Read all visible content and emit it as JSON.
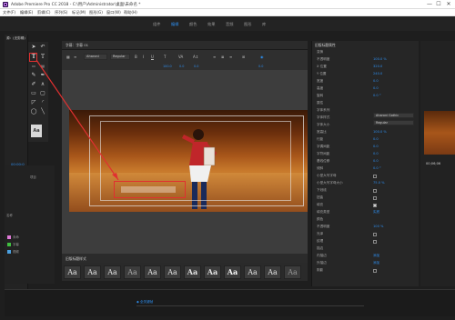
{
  "window": {
    "title": "Adobe Premiere Pro CC 2018 - C:\\用户\\Administrator\\桌面\\未命名 *",
    "controls": [
      "—",
      "☐",
      "✕"
    ]
  },
  "menu": [
    "文件(F)",
    "编辑(E)",
    "剪辑(C)",
    "序列(S)",
    "标记(M)",
    "图形(G)",
    "窗口(W)",
    "帮助(H)"
  ],
  "workspace_tabs": [
    "组件",
    "编辑",
    "颜色",
    "效果",
    "音频",
    "图形",
    "库"
  ],
  "left_panel": {
    "tab": "源：(无剪辑)",
    "timecode": "00;00;0"
  },
  "project_panel": {
    "labels": [
      "项目",
      "名称"
    ],
    "rows": [
      {
        "label": "未命",
        "color": "#e07ad8"
      },
      {
        "label": "字幕",
        "color": "#40c040"
      },
      {
        "label": "视频",
        "color": "#4aa0e0"
      }
    ]
  },
  "titler": {
    "title": "字幕：字幕 01",
    "font_family": "Aharoni",
    "font_style": "Regular",
    "values": [
      "100.0",
      "0.0",
      "0.0",
      "0.0",
      "0.0",
      "0.0"
    ],
    "styles_title": "旧版标题样式",
    "styles": [
      "Aa",
      "Aa",
      "Aa",
      "Aa",
      "Aa",
      "Aa",
      "Aa",
      "Aa",
      "Aa",
      "Aa",
      "Aa",
      "Aa"
    ]
  },
  "properties": {
    "title": "旧版标题属性",
    "rows": [
      {
        "label": "变换",
        "value": ""
      },
      {
        "label": "不透明度",
        "value": "100.0 %"
      },
      {
        "label": "X 位置",
        "value": "320.0"
      },
      {
        "label": "Y 位置",
        "value": "240.0"
      },
      {
        "label": "宽度",
        "value": "0.0"
      },
      {
        "label": "高度",
        "value": "0.0"
      },
      {
        "label": "旋转",
        "value": "0.0 °"
      },
      {
        "label": "属性",
        "value": ""
      },
      {
        "label": "字体系列",
        "value": ""
      },
      {
        "label": "字体样式",
        "value": ""
      },
      {
        "label": "字体大小",
        "value": "100.0"
      },
      {
        "label": "宽高比",
        "value": "100.0 %"
      },
      {
        "label": "行距",
        "value": "0.0"
      },
      {
        "label": "字偶间距",
        "value": "0.0"
      },
      {
        "label": "字符间距",
        "value": "0.0"
      },
      {
        "label": "基线位移",
        "value": "0.0"
      },
      {
        "label": "倾斜",
        "value": "0.0 °"
      },
      {
        "label": "小型大写字母",
        "value": ""
      },
      {
        "label": "小型大写字母大小",
        "value": "75.0 %"
      },
      {
        "label": "下划线",
        "value": ""
      },
      {
        "label": "扭曲",
        "value": ""
      },
      {
        "label": "填充",
        "value": ""
      },
      {
        "label": "填充类型",
        "value": "实底"
      },
      {
        "label": "颜色",
        "value": ""
      },
      {
        "label": "不透明度",
        "value": "100 %"
      },
      {
        "label": "光泽",
        "value": ""
      },
      {
        "label": "纹理",
        "value": ""
      },
      {
        "label": "描边",
        "value": ""
      },
      {
        "label": "内描边",
        "value": "添加"
      },
      {
        "label": "外描边",
        "value": "添加"
      },
      {
        "label": "阴影",
        "value": ""
      }
    ],
    "font_family": "Aharoni Gothic",
    "font_style": "Regular"
  },
  "program": {
    "timecode": "00;06;06"
  },
  "timeline": {
    "marker": "◆ 全关键帧"
  },
  "colors": {
    "accent_blue": "#2d8ceb",
    "highlight_red": "#e03030",
    "panel_bg": "#232323"
  },
  "icons": [
    "selection-arrow-icon",
    "rotate-icon",
    "text-tool-icon",
    "vertical-text-icon",
    "pen-icon",
    "rectangle-icon",
    "ellipse-icon",
    "close-icon",
    "minimize-icon",
    "maximize-icon"
  ]
}
